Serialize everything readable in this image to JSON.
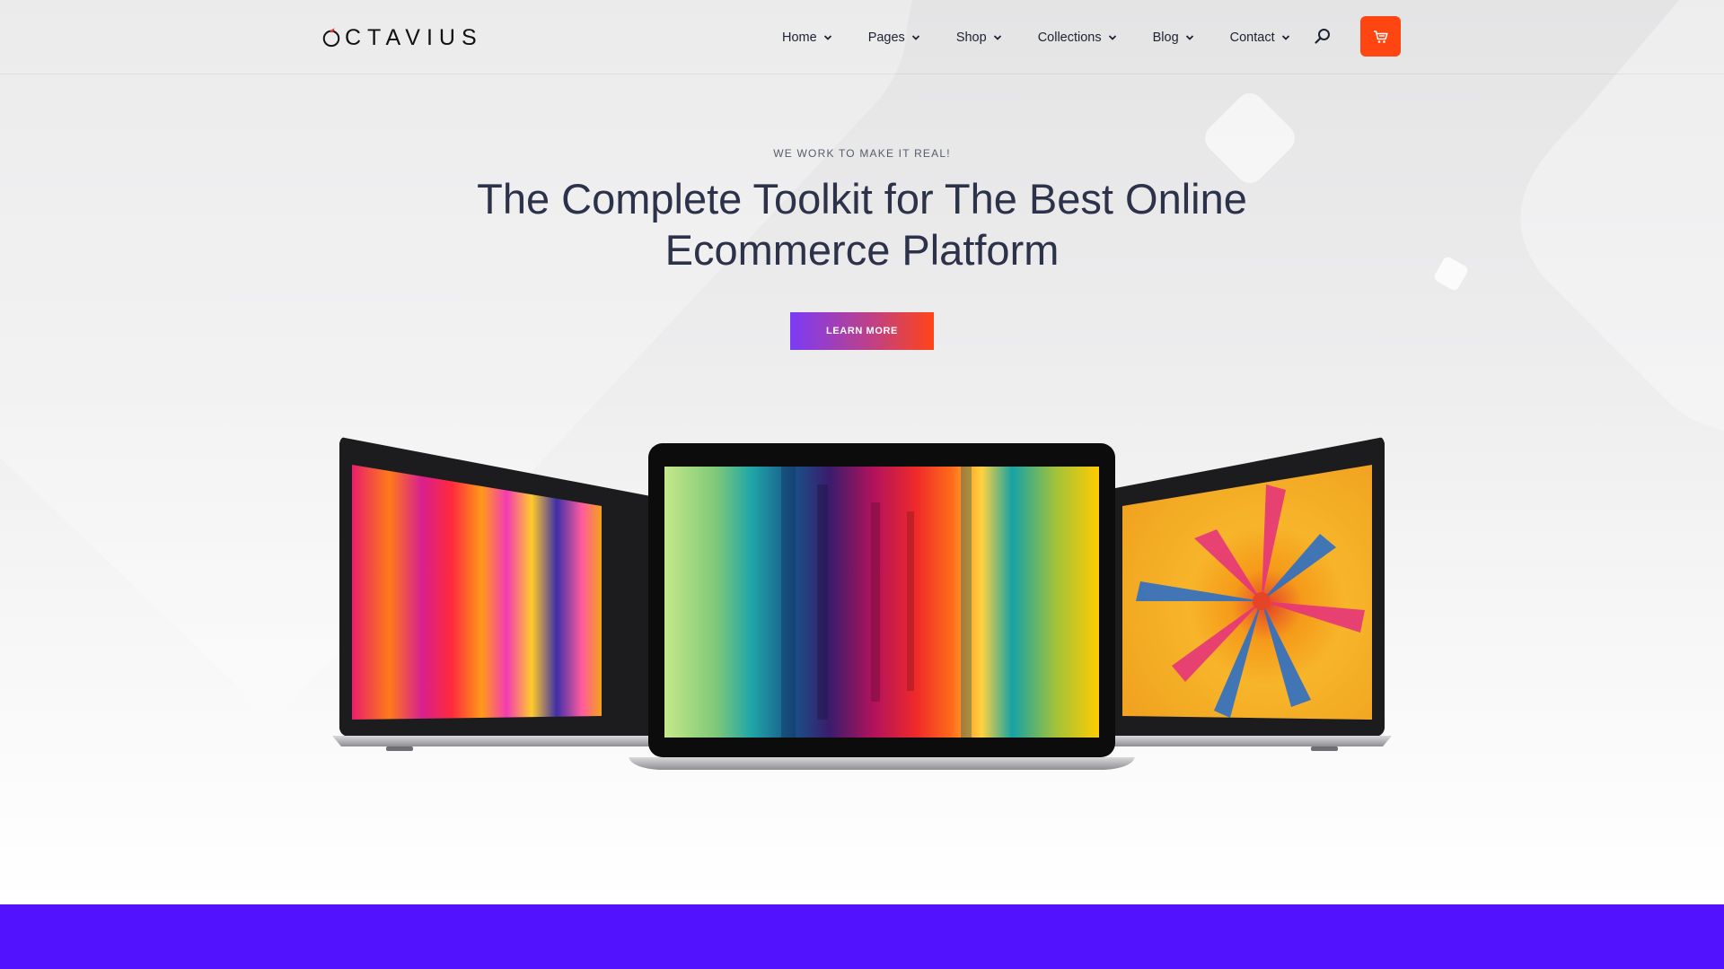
{
  "brand": {
    "name": "CTAVIUS",
    "accent": "#e62f3a"
  },
  "nav": {
    "items": [
      {
        "label": "Home"
      },
      {
        "label": "Pages"
      },
      {
        "label": "Shop"
      },
      {
        "label": "Collections"
      },
      {
        "label": "Blog"
      },
      {
        "label": "Contact"
      }
    ],
    "search_icon": "search-icon",
    "cart_icon": "cart-icon",
    "cart_color": "#ff4511"
  },
  "hero": {
    "tagline": "WE WORK TO MAKE IT REAL!",
    "headline_line1": "The Complete Toolkit for The Best Online",
    "headline_line2": "Ecommerce Platform",
    "cta_label": "LEARN MORE",
    "cta_gradient": [
      "#7a3cf6",
      "#ff4416"
    ]
  },
  "devices": [
    {
      "name": "laptop-left",
      "screen": "neon-stripes"
    },
    {
      "name": "laptop-center",
      "screen": "rainbow-corridor"
    },
    {
      "name": "laptop-right",
      "screen": "balloon-pattern"
    }
  ],
  "footer_band_color": "#5212fd"
}
